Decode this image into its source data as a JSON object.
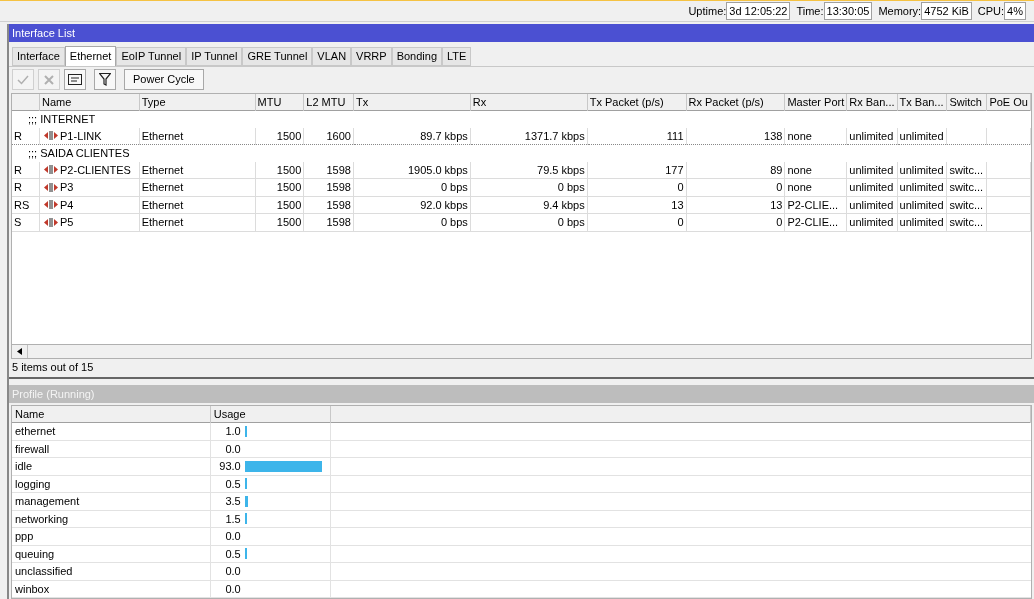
{
  "status_bar": [
    {
      "label": "Uptime:",
      "value": "3d 12:05:22"
    },
    {
      "label": "Time:",
      "value": "13:30:05"
    },
    {
      "label": "Memory:",
      "value": "4752 KiB"
    },
    {
      "label": "CPU:",
      "value": "4%"
    }
  ],
  "window": {
    "title": "Interface List"
  },
  "tabs": [
    {
      "label": "Interface",
      "selected": false
    },
    {
      "label": "Ethernet",
      "selected": true
    },
    {
      "label": "EoIP Tunnel",
      "selected": false
    },
    {
      "label": "IP Tunnel",
      "selected": false
    },
    {
      "label": "GRE Tunnel",
      "selected": false
    },
    {
      "label": "VLAN",
      "selected": false
    },
    {
      "label": "VRRP",
      "selected": false
    },
    {
      "label": "Bonding",
      "selected": false
    },
    {
      "label": "LTE",
      "selected": false
    }
  ],
  "toolbar": [
    {
      "kind": "enable",
      "disabled": true
    },
    {
      "kind": "disable",
      "disabled": true
    },
    {
      "kind": "comment",
      "disabled": false
    },
    {
      "kind": "filter",
      "disabled": false
    }
  ],
  "power_cycle_button": "Power Cycle",
  "table": {
    "columns": [
      "Name",
      "Type",
      "MTU",
      "L2 MTU",
      "Tx",
      "Rx",
      "Tx Packet (p/s)",
      "Rx Packet (p/s)",
      "Master Port",
      "Rx Ban...",
      "Tx Ban...",
      "Switch",
      "PoE Ou"
    ],
    "groups": [
      {
        "comment": ";;; INTERNET",
        "rows": [
          {
            "flags": "R",
            "name": "P1-LINK",
            "type": "Ethernet",
            "mtu": "1500",
            "l2mtu": "1600",
            "tx": "89.7 kbps",
            "rx": "1371.7 kbps",
            "tx_packet": "111",
            "rx_packet": "138",
            "master_port": "none",
            "rx_ban": "unlimited",
            "tx_ban": "unlimited",
            "switch": ""
          }
        ]
      },
      {
        "comment": ";;; SAIDA CLIENTES",
        "rows": [
          {
            "flags": "R",
            "name": "P2-CLIENTES",
            "type": "Ethernet",
            "mtu": "1500",
            "l2mtu": "1598",
            "tx": "1905.0 kbps",
            "rx": "79.5 kbps",
            "tx_packet": "177",
            "rx_packet": "89",
            "master_port": "none",
            "rx_ban": "unlimited",
            "tx_ban": "unlimited",
            "switch": "switc..."
          },
          {
            "flags": "R",
            "name": "P3",
            "type": "Ethernet",
            "mtu": "1500",
            "l2mtu": "1598",
            "tx": "0 bps",
            "rx": "0 bps",
            "tx_packet": "0",
            "rx_packet": "0",
            "master_port": "none",
            "rx_ban": "unlimited",
            "tx_ban": "unlimited",
            "switch": "switc..."
          },
          {
            "flags": "RS",
            "name": "P4",
            "type": "Ethernet",
            "mtu": "1500",
            "l2mtu": "1598",
            "tx": "92.0 kbps",
            "rx": "9.4 kbps",
            "tx_packet": "13",
            "rx_packet": "13",
            "master_port": "P2-CLIE...",
            "rx_ban": "unlimited",
            "tx_ban": "unlimited",
            "switch": "switc..."
          },
          {
            "flags": "S",
            "name": "P5",
            "type": "Ethernet",
            "mtu": "1500",
            "l2mtu": "1598",
            "tx": "0 bps",
            "rx": "0 bps",
            "tx_packet": "0",
            "rx_packet": "0",
            "master_port": "P2-CLIE...",
            "rx_ban": "unlimited",
            "tx_ban": "unlimited",
            "switch": "switc..."
          }
        ]
      }
    ]
  },
  "items_count": "5 items out of 15",
  "profile": {
    "title": "Profile (Running)",
    "columns": [
      "Name",
      "Usage"
    ],
    "rows": [
      {
        "name": "ethernet",
        "usage": "1.0"
      },
      {
        "name": "firewall",
        "usage": "0.0"
      },
      {
        "name": "idle",
        "usage": "93.0"
      },
      {
        "name": "logging",
        "usage": "0.5"
      },
      {
        "name": "management",
        "usage": "3.5"
      },
      {
        "name": "networking",
        "usage": "1.5"
      },
      {
        "name": "ppp",
        "usage": "0.0"
      },
      {
        "name": "queuing",
        "usage": "0.5"
      },
      {
        "name": "unclassified",
        "usage": "0.0"
      },
      {
        "name": "winbox",
        "usage": "0.0"
      }
    ]
  }
}
